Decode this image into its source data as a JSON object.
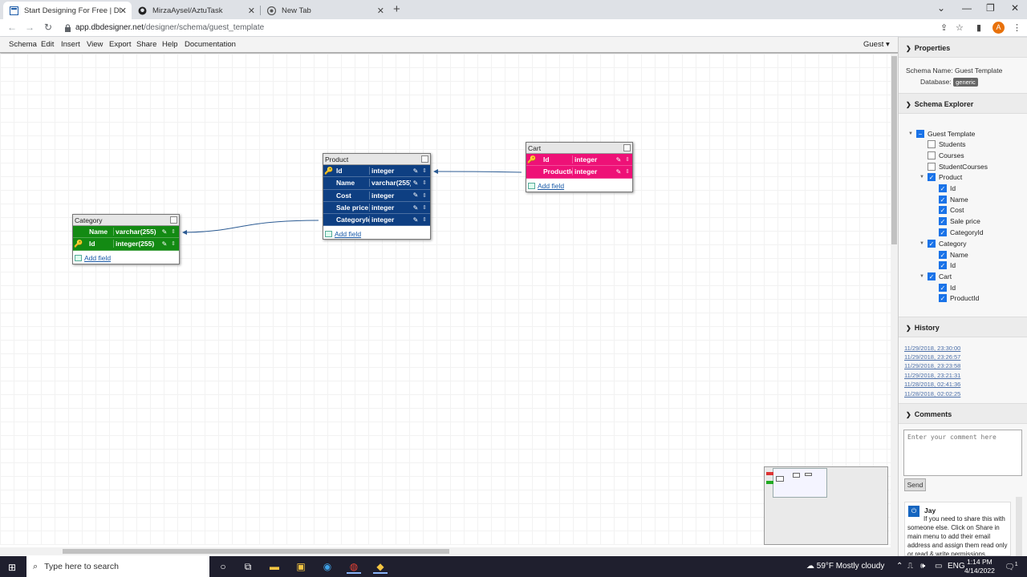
{
  "browser": {
    "tabs": [
      {
        "title": "Start Designing For Free | DbDes",
        "active": true
      },
      {
        "title": "MirzaAysel/AztuTask",
        "active": false
      },
      {
        "title": "New Tab",
        "active": false
      }
    ],
    "url_host": "app.dbdesigner.net",
    "url_path": "/designer/schema/guest_template",
    "profile_initial": "A",
    "new_tab_symbol": "+"
  },
  "menu": {
    "items": [
      "Schema",
      "Edit",
      "Insert",
      "View",
      "Export",
      "Share",
      "Help",
      "Documentation"
    ],
    "user": "Guest"
  },
  "tables": {
    "product": {
      "name": "Product",
      "color": "#0e3f82",
      "fields": [
        {
          "name": "Id",
          "type": "integer",
          "pk": true
        },
        {
          "name": "Name",
          "type": "varchar(255)",
          "pk": false
        },
        {
          "name": "Cost",
          "type": "integer",
          "pk": false
        },
        {
          "name": "Sale price",
          "type": "integer",
          "pk": false
        },
        {
          "name": "CategoryId",
          "type": "integer",
          "pk": false
        }
      ],
      "add_field": "Add field"
    },
    "cart": {
      "name": "Cart",
      "color": "#ee1177",
      "fields": [
        {
          "name": "Id",
          "type": "integer",
          "pk": true
        },
        {
          "name": "ProductId",
          "type": "integer",
          "pk": false
        }
      ],
      "add_field": "Add field"
    },
    "category": {
      "name": "Category",
      "color": "#138a13",
      "fields": [
        {
          "name": "Name",
          "type": "varchar(255)",
          "pk": false
        },
        {
          "name": "Id",
          "type": "integer(255)",
          "pk": true
        }
      ],
      "add_field": "Add field"
    }
  },
  "panel": {
    "properties": {
      "title": "Properties",
      "schema_name_label": "Schema Name:",
      "schema_name": "Guest Template",
      "database_label": "Database:",
      "database": "generic"
    },
    "explorer": {
      "title": "Schema Explorer",
      "root": "Guest Template",
      "unchecked": [
        "Students",
        "Courses",
        "StudentCourses"
      ],
      "tables": [
        {
          "name": "Product",
          "fields": [
            "Id",
            "Name",
            "Cost",
            "Sale price",
            "CategoryId"
          ]
        },
        {
          "name": "Category",
          "fields": [
            "Name",
            "Id"
          ]
        },
        {
          "name": "Cart",
          "fields": [
            "Id",
            "ProductId"
          ]
        }
      ]
    },
    "history": {
      "title": "History",
      "entries": [
        "11/29/2018, 23:30:00",
        "11/29/2018, 23:26:57",
        "11/29/2018, 23:23:58",
        "11/29/2018, 23:21:31",
        "11/28/2018, 02:41:36",
        "11/28/2018, 02:02:25"
      ]
    },
    "comments": {
      "title": "Comments",
      "placeholder": "Enter your comment here",
      "send": "Send",
      "author": "Jay",
      "message": "If you need to share this with someone else. Click on Share in main menu to add their email address and assign them read only or read & write permissions."
    }
  },
  "taskbar": {
    "search_placeholder": "Type here to search",
    "weather": "59°F  Mostly cloudy",
    "lang": "ENG",
    "time": "1:14 PM",
    "date": "4/14/2022",
    "notif_count": "1"
  }
}
